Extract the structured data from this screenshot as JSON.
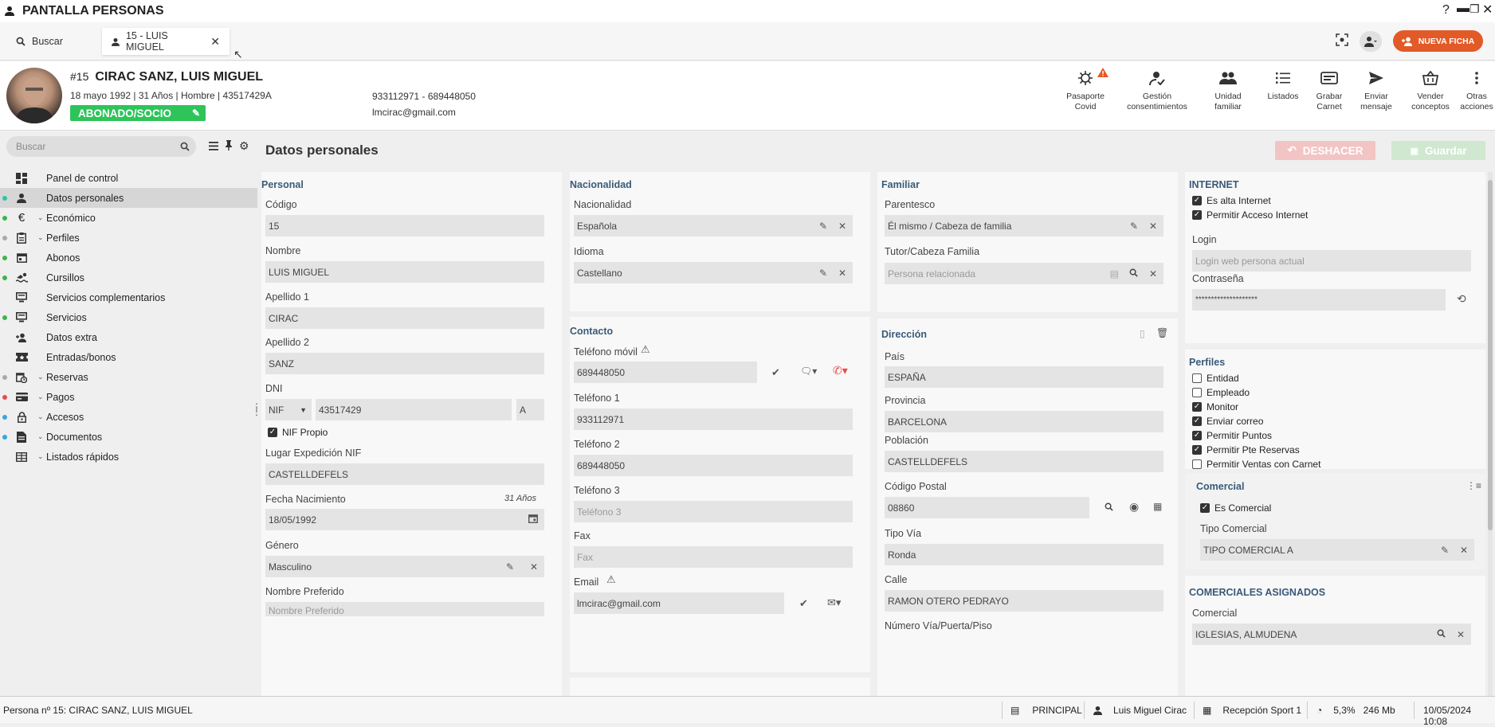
{
  "window": {
    "title": "PANTALLA PERSONAS"
  },
  "tabs": {
    "search_label": "Buscar",
    "person_tab": "15 - LUIS MIGUEL",
    "new_button": "NUEVA FICHA"
  },
  "person": {
    "number": "#15",
    "name": "CIRAC SANZ, LUIS MIGUEL",
    "info": "18 mayo 1992 | 31 Años | Hombre | 43517429A",
    "badge": "ABONADO/SOCIO",
    "phones": "933112971 - 689448050",
    "email": "lmcirac@gmail.com"
  },
  "toolbar": [
    {
      "line1": "Pasaporte",
      "line2": "Covid",
      "icon": "virus-icon"
    },
    {
      "line1": "Gestión",
      "line2": "consentimientos",
      "icon": "user-check-icon"
    },
    {
      "line1": "Unidad",
      "line2": "familiar",
      "icon": "group-icon"
    },
    {
      "line1": "Listados",
      "line2": "",
      "icon": "list-icon"
    },
    {
      "line1": "Grabar",
      "line2": "Carnet",
      "icon": "card-icon"
    },
    {
      "line1": "Enviar",
      "line2": "mensaje",
      "icon": "send-icon"
    },
    {
      "line1": "Vender",
      "line2": "conceptos",
      "icon": "basket-icon"
    },
    {
      "line1": "Otras",
      "line2": "acciones",
      "icon": "more-icon"
    }
  ],
  "sidebar": {
    "search_placeholder": "Buscar",
    "items": [
      {
        "label": "Panel de control",
        "dot": "",
        "chev": false
      },
      {
        "label": "Datos personales",
        "dot": "#2ec4a8",
        "chev": false
      },
      {
        "label": "Económico",
        "dot": "#3cb44b",
        "chev": true
      },
      {
        "label": "Perfiles",
        "dot": "#aaaaaa",
        "chev": true
      },
      {
        "label": "Abonos",
        "dot": "#3cb44b",
        "chev": false
      },
      {
        "label": "Cursillos",
        "dot": "#3cb44b",
        "chev": false
      },
      {
        "label": "Servicios complementarios",
        "dot": "",
        "chev": false
      },
      {
        "label": "Servicios",
        "dot": "#3cb44b",
        "chev": false
      },
      {
        "label": "Datos extra",
        "dot": "",
        "chev": false
      },
      {
        "label": "Entradas/bonos",
        "dot": "",
        "chev": false
      },
      {
        "label": "Reservas",
        "dot": "#aaaaaa",
        "chev": true
      },
      {
        "label": "Pagos",
        "dot": "#e84b4b",
        "chev": true
      },
      {
        "label": "Accesos",
        "dot": "#3aa4e0",
        "chev": true
      },
      {
        "label": "Documentos",
        "dot": "#3aa4e0",
        "chev": true
      },
      {
        "label": "Listados rápidos",
        "dot": "",
        "chev": true
      }
    ]
  },
  "main": {
    "title": "Datos personales",
    "undo": "DESHACER",
    "save": "Guardar",
    "personal": {
      "header": "Personal",
      "codigo_l": "Código",
      "codigo": "15",
      "nombre_l": "Nombre",
      "nombre": "LUIS MIGUEL",
      "ap1_l": "Apellido 1",
      "ap1": "CIRAC",
      "ap2_l": "Apellido 2",
      "ap2": "SANZ",
      "dni_l": "DNI",
      "dni_type": "NIF",
      "dni_num": "43517429",
      "dni_letter": "A",
      "nif_propio": "NIF Propio",
      "lugar_l": "Lugar Expedición NIF",
      "lugar": "CASTELLDEFELS",
      "fecha_l": "Fecha Nacimiento",
      "fecha_age": "31 Años",
      "fecha": "18/05/1992",
      "genero_l": "Género",
      "genero": "Masculino",
      "pref_l": "Nombre Preferido",
      "pref_ph": "Nombre Preferido"
    },
    "nacionalidad": {
      "header": "Nacionalidad",
      "nac_l": "Nacionalidad",
      "nac": "Española",
      "idioma_l": "Idioma",
      "idioma": "Castellano"
    },
    "contacto": {
      "header": "Contacto",
      "movil_l": "Teléfono móvil",
      "movil": "689448050",
      "t1_l": "Teléfono 1",
      "t1": "933112971",
      "t2_l": "Teléfono 2",
      "t2": "689448050",
      "t3_l": "Teléfono 3",
      "t3_ph": "Teléfono 3",
      "fax_l": "Fax",
      "fax_ph": "Fax",
      "email_l": "Email",
      "email": "lmcirac@gmail.com"
    },
    "familiar": {
      "header": "Familiar",
      "par_l": "Parentesco",
      "par": "Él mismo / Cabeza de familia",
      "tutor_l": "Tutor/Cabeza Familia",
      "tutor_ph": "Persona relacionada"
    },
    "direccion": {
      "header": "Dirección",
      "pais_l": "País",
      "pais": "ESPAÑA",
      "prov_l": "Provincia",
      "prov": "BARCELONA",
      "pob_l": "Población",
      "pob": "CASTELLDEFELS",
      "cp_l": "Código Postal",
      "cp": "08860",
      "via_l": "Tipo Vía",
      "via": "Ronda",
      "calle_l": "Calle",
      "calle": "RAMON OTERO PEDRAYO",
      "num_l": "Número Vía/Puerta/Piso"
    },
    "internet": {
      "header": "INTERNET",
      "alta": "Es alta Internet",
      "acceso": "Permitir Acceso Internet",
      "login_l": "Login",
      "login_ph": "Login web persona actual",
      "pass_l": "Contraseña",
      "pass": "********************"
    },
    "perfiles": {
      "header": "Perfiles",
      "items": [
        {
          "label": "Entidad",
          "on": false
        },
        {
          "label": "Empleado",
          "on": false
        },
        {
          "label": "Monitor",
          "on": true
        },
        {
          "label": "Enviar correo",
          "on": true
        },
        {
          "label": "Permitir Puntos",
          "on": true
        },
        {
          "label": "Permitir Pte Reservas",
          "on": true
        },
        {
          "label": "Permitir Ventas con Carnet",
          "on": false
        }
      ]
    },
    "comercial": {
      "header": "Comercial",
      "es": "Es Comercial",
      "tipo_l": "Tipo Comercial",
      "tipo": "TIPO COMERCIAL A"
    },
    "asignados": {
      "header": "COMERCIALES ASIGNADOS",
      "com_l": "Comercial",
      "com": "IGLESIAS, ALMUDENA"
    }
  },
  "status": {
    "left": "Persona nº 15: CIRAC SANZ, LUIS MIGUEL",
    "server": "PRINCIPAL",
    "user": "Luis Miguel Cirac",
    "location": "Recepción Sport 1",
    "cpu": "5,3%",
    "mem": "246 Mb",
    "datetime": "10/05/2024 10:08"
  }
}
